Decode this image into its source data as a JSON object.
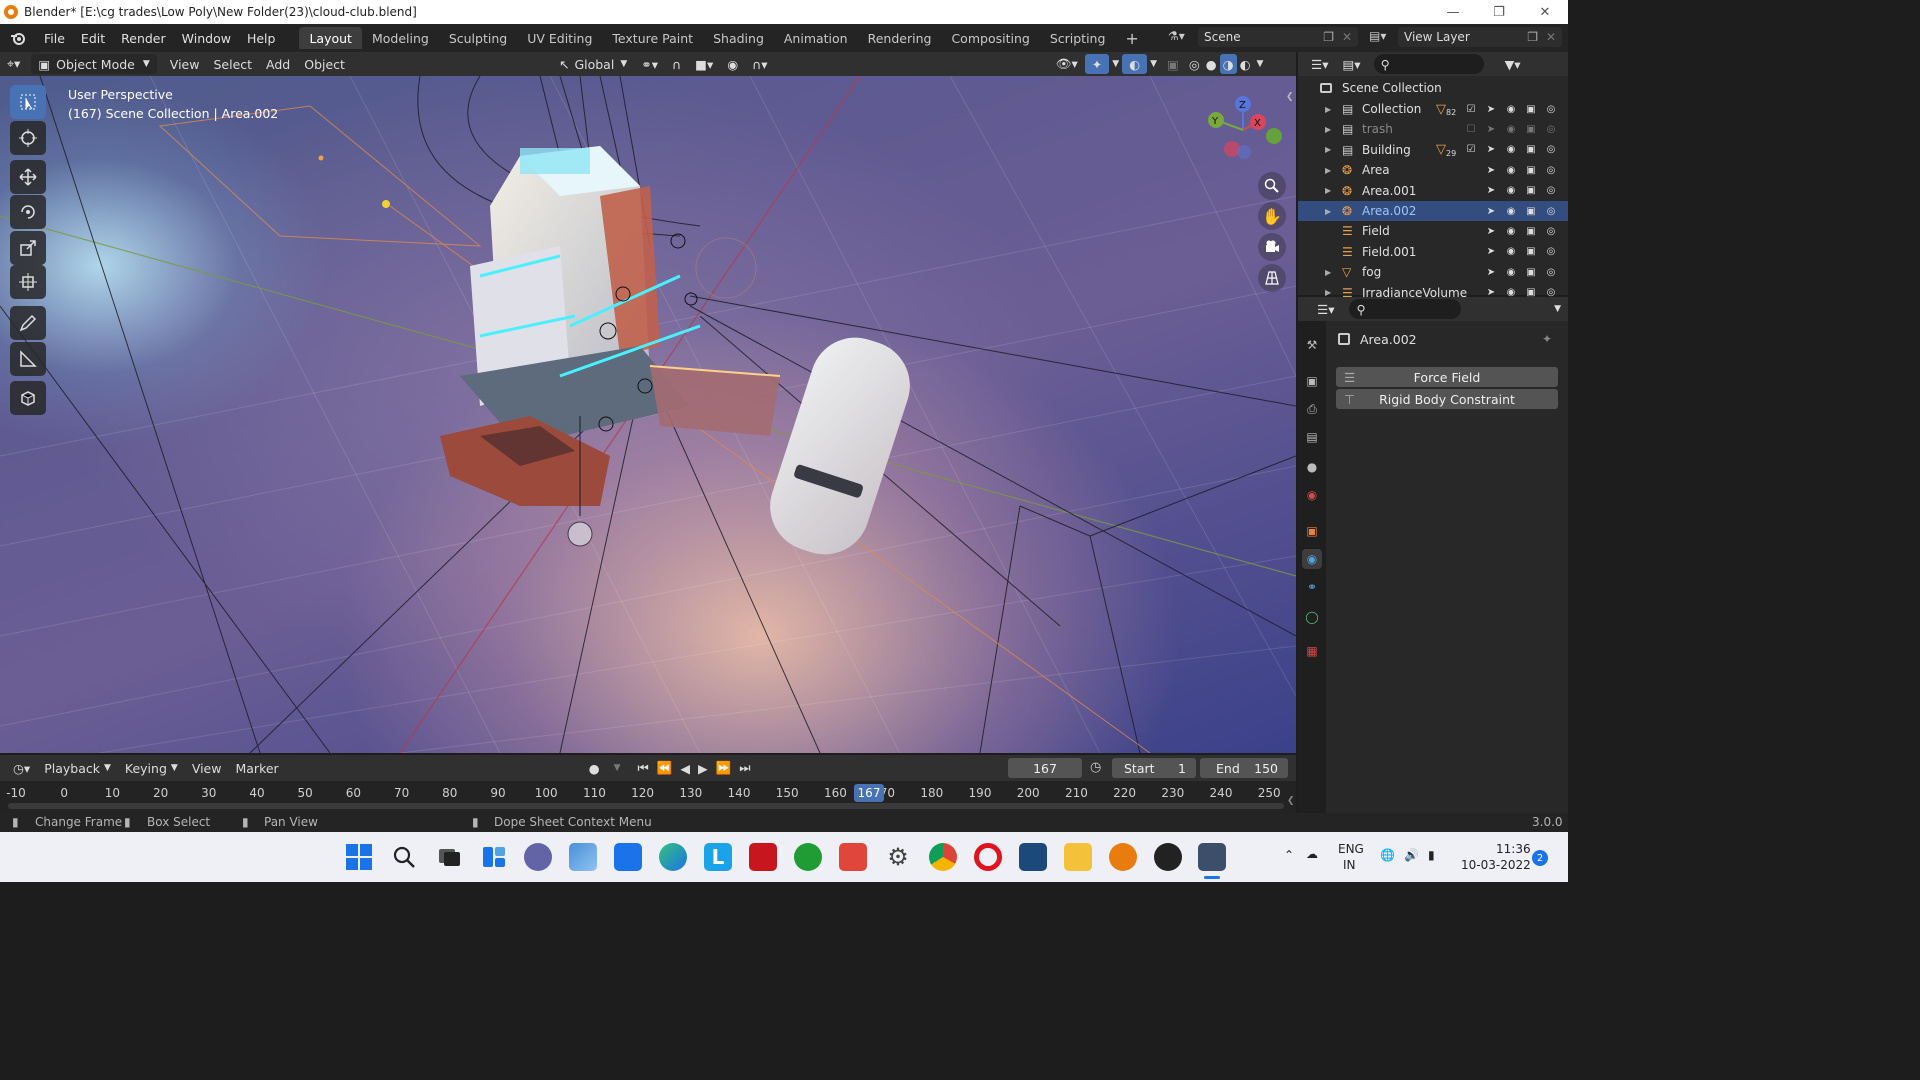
{
  "window": {
    "title": "Blender* [E:\\cg trades\\Low Poly\\New Folder(23)\\cloud-club.blend]"
  },
  "menu": {
    "file": "File",
    "edit": "Edit",
    "render": "Render",
    "window": "Window",
    "help": "Help"
  },
  "workspaces": [
    "Layout",
    "Modeling",
    "Sculpting",
    "UV Editing",
    "Texture Paint",
    "Shading",
    "Animation",
    "Rendering",
    "Compositing",
    "Scripting",
    "+"
  ],
  "active_workspace": "Layout",
  "scene": {
    "label": "Scene",
    "view_layer": "View Layer"
  },
  "viewport_header": {
    "mode": "Object Mode",
    "view": "View",
    "select": "Select",
    "add": "Add",
    "object": "Object",
    "orientation": "Global"
  },
  "viewport": {
    "perspective": "User Perspective",
    "context": "(167) Scene Collection | Area.002"
  },
  "gizmo": {
    "x": "X",
    "y": "Y",
    "z": "Z"
  },
  "outliner": {
    "root": "Scene Collection",
    "items": [
      {
        "name": "Collection",
        "count": "82",
        "kind": "collection",
        "selected": false,
        "enabled": true
      },
      {
        "name": "trash",
        "count": "",
        "kind": "collection",
        "selected": false,
        "enabled": false
      },
      {
        "name": "Building",
        "count": "29",
        "kind": "collection",
        "selected": false,
        "enabled": true
      },
      {
        "name": "Area",
        "count": "",
        "kind": "light",
        "selected": false,
        "enabled": true
      },
      {
        "name": "Area.001",
        "count": "",
        "kind": "light",
        "selected": false,
        "enabled": true
      },
      {
        "name": "Area.002",
        "count": "",
        "kind": "light",
        "selected": true,
        "enabled": true
      },
      {
        "name": "Field",
        "count": "",
        "kind": "field",
        "selected": false,
        "enabled": true
      },
      {
        "name": "Field.001",
        "count": "",
        "kind": "field",
        "selected": false,
        "enabled": true
      },
      {
        "name": "fog",
        "count": "",
        "kind": "mesh",
        "selected": false,
        "enabled": true
      },
      {
        "name": "IrradianceVolume",
        "count": "",
        "kind": "probe",
        "selected": false,
        "enabled": true
      }
    ]
  },
  "properties": {
    "object_name": "Area.002",
    "buttons": [
      "Force Field",
      "Rigid Body Constraint"
    ]
  },
  "timeline": {
    "playback": "Playback",
    "keying": "Keying",
    "view": "View",
    "marker": "Marker",
    "current_frame": "167",
    "start_label": "Start",
    "start": "1",
    "end_label": "End",
    "end": "150",
    "ticks": [
      "-10",
      "0",
      "10",
      "20",
      "30",
      "40",
      "50",
      "60",
      "70",
      "80",
      "90",
      "100",
      "110",
      "120",
      "130",
      "140",
      "150",
      "160",
      "170",
      "180",
      "190",
      "200",
      "210",
      "220",
      "230",
      "240",
      "250"
    ]
  },
  "statusbar": {
    "change_frame": "Change Frame",
    "box_select": "Box Select",
    "pan_view": "Pan View",
    "context_menu": "Dope Sheet Context Menu",
    "version": "3.0.0"
  },
  "taskbar": {
    "lang": "ENG",
    "region": "IN",
    "time": "11:36",
    "date": "10-03-2022",
    "notifications": "2"
  },
  "colors": {
    "accent": "#4772b3",
    "selected_row": "#334d80",
    "frame_marker": "#4772b3",
    "blender_orange": "#e87d0d"
  }
}
